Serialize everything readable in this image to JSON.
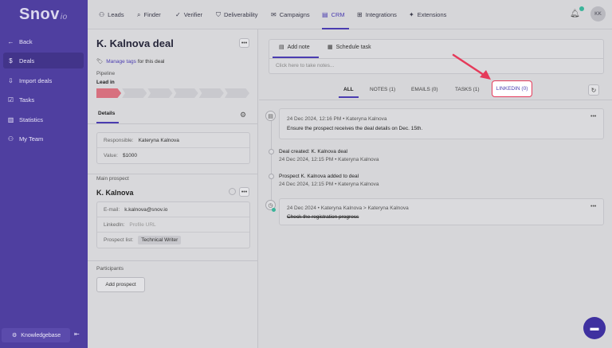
{
  "brand": {
    "name": "Snov",
    "suffix": "io"
  },
  "sidebar": {
    "items": [
      {
        "label": "Back",
        "icon": "arrow-left-icon"
      },
      {
        "label": "Deals",
        "icon": "dollar-icon"
      },
      {
        "label": "Import deals",
        "icon": "import-icon"
      },
      {
        "label": "Tasks",
        "icon": "tasks-icon"
      },
      {
        "label": "Statistics",
        "icon": "chart-icon"
      },
      {
        "label": "My Team",
        "icon": "team-icon"
      }
    ],
    "knowledgebase": "Knowledgebase"
  },
  "topnav": {
    "items": [
      "Leads",
      "Finder",
      "Verifier",
      "Deliverability",
      "Campaigns",
      "CRM",
      "Integrations",
      "Extensions"
    ],
    "active": "CRM",
    "avatar": "KK"
  },
  "deal": {
    "title": "K. Kalnova deal",
    "manage_tags": "Manage tags",
    "tags_suffix": "for this deal",
    "pipeline_label": "Pipeline",
    "stage": "Lead in",
    "details_tab": "Details",
    "responsible_label": "Responsible:",
    "responsible_value": "Kateryna Kalnova",
    "value_label": "Value:",
    "value_value": "$1000",
    "main_prospect_label": "Main prospect",
    "prospect_name": "K. Kalnova",
    "email_label": "E-mail:",
    "email_value": "k.kalnova@snov.io",
    "linkedin_label": "LinkedIn:",
    "linkedin_placeholder": "Profile URL",
    "list_label": "Prospect list:",
    "list_value": "Technical Writer",
    "participants_label": "Participants",
    "add_prospect": "Add prospect"
  },
  "composer": {
    "add_note": "Add note",
    "schedule_task": "Schedule task",
    "placeholder": "Click here to take notes..."
  },
  "filters": {
    "all": "ALL",
    "notes": "NOTES (1)",
    "emails": "EMAILS (0)",
    "tasks": "TASKS (1)",
    "linkedin": "LINKEDIN (0)"
  },
  "timeline": {
    "note": {
      "meta": "24 Dec 2024, 12:16 PM  •  Kateryna Kalnova",
      "text": "Ensure the prospect receives the deal details on Dec. 15th."
    },
    "event1": {
      "text": "Deal created: K. Kalnova deal",
      "meta": "24 Dec 2024, 12:15 PM  •  Kateryna Kalnova"
    },
    "event2": {
      "text": "Prospect K. Kalnova added to deal",
      "meta": "24 Dec 2024, 12:15 PM  •  Kateryna Kalnova"
    },
    "task": {
      "meta": "24 Dec 2024  •  Kateryna Kalnova  >  Kateryna Kalnova",
      "text": "Check the registration progress"
    }
  },
  "colors": {
    "sidebar": "#4f3fa0",
    "accent": "#4a3cb0",
    "highlight": "#e53a5a",
    "pipeline_active": "#d7707f"
  }
}
